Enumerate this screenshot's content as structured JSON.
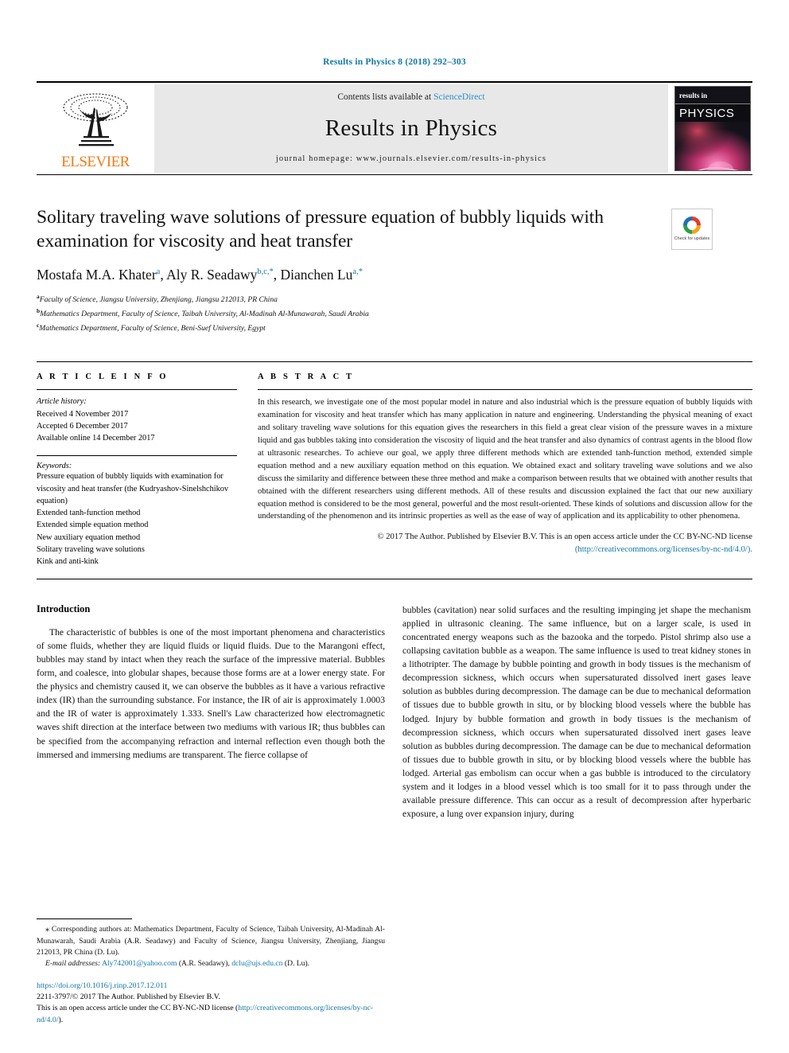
{
  "running_head": "Results in Physics 8 (2018) 292–303",
  "masthead": {
    "contents_prefix": "Contents lists available at ",
    "sciencedirect": "ScienceDirect",
    "journal_name": "Results in Physics",
    "homepage": "journal homepage: www.journals.elsevier.com/results-in-physics",
    "publisher": "ELSEVIER",
    "cover_top": "results in",
    "cover_title": "PHYSICS"
  },
  "article": {
    "title": "Solitary traveling wave solutions of pressure equation of bubbly liquids with examination for viscosity and heat transfer",
    "crossmark_label": "Check for updates",
    "authors_html": "Mostafa M.A. Khater a, Aly R. Seadawy b,c,*, Dianchen Lu a,*",
    "author1": "Mostafa M.A. Khater",
    "author1_sup": "a",
    "author2": "Aly R. Seadawy",
    "author2_sup": "b,c,*",
    "author3": "Dianchen Lu",
    "author3_sup": "a,*",
    "affiliations": [
      {
        "mark": "a",
        "text": "Faculty of Science, Jiangsu University, Zhenjiang, Jiangsu 212013, PR China"
      },
      {
        "mark": "b",
        "text": "Mathematics Department, Faculty of Science, Taibah University, Al-Madinah Al-Munawarah, Saudi Arabia"
      },
      {
        "mark": "c",
        "text": "Mathematics Department, Faculty of Science, Beni-Suef University, Egypt"
      }
    ]
  },
  "article_info": {
    "heading": "A R T I C L E   I N F O",
    "history_title": "Article history:",
    "history": [
      "Received 4 November 2017",
      "Accepted 6 December 2017",
      "Available online 14 December 2017"
    ],
    "keywords_title": "Keywords:",
    "keywords": [
      "Pressure equation of bubbly liquids with examination for viscosity and heat transfer (the Kudryashov-Sinelshchikov equation)",
      "Extended tanh-function method",
      "Extended simple equation method",
      "New auxiliary equation method",
      "Solitary traveling wave solutions",
      "Kink and anti-kink"
    ]
  },
  "abstract": {
    "heading": "A B S T R A C T",
    "text": "In this research, we investigate one of the most popular model in nature and also industrial which is the pressure equation of bubbly liquids with examination for viscosity and heat transfer which has many application in nature and engineering. Understanding the physical meaning of exact and solitary traveling wave solutions for this equation gives the researchers in this field a great clear vision of the pressure waves in a mixture liquid and gas bubbles taking into consideration the viscosity of liquid and the heat transfer and also dynamics of contrast agents in the blood flow at ultrasonic researches. To achieve our goal, we apply three different methods which are extended tanh-function method, extended simple equation method and a new auxiliary equation method on this equation. We obtained exact and solitary traveling wave solutions and we also discuss the similarity and difference between these three method and make a comparison between results that we obtained with another results that obtained with the different researchers using different methods. All of these results and discussion explained the fact that our new auxiliary equation method is considered to be the most general, powerful and the most result-oriented. These kinds of solutions and discussion allow for the understanding of the phenomenon and its intrinsic properties as well as the ease of way of application and its applicability to other phenomena.",
    "copyright": "© 2017 The Author. Published by Elsevier B.V. This is an open access article under the CC BY-NC-ND license",
    "license_url": "(http://creativecommons.org/licenses/by-nc-nd/4.0/)."
  },
  "body": {
    "intro_heading": "Introduction",
    "left_paragraph": "The characteristic of bubbles is one of the most important phenomena and characteristics of some fluids, whether they are liquid fluids or liquid fluids. Due to the Marangoni effect, bubbles may stand by intact when they reach the surface of the impressive material. Bubbles form, and coalesce, into globular shapes, because those forms are at a lower energy state. For the physics and chemistry caused it, we can observe the bubbles as it have a various refractive index (IR) than the surrounding substance. For instance, the IR of air is approximately 1.0003 and the IR of water is approximately 1.333. Snell's Law characterized how electromagnetic waves shift direction at the interface between two mediums with various IR; thus bubbles can be specified from the accompanying refraction and internal reflection even though both the immersed and immersing mediums are transparent. The fierce collapse of",
    "right_paragraph": "bubbles (cavitation) near solid surfaces and the resulting impinging jet shape the mechanism applied in ultrasonic cleaning. The same influence, but on a larger scale, is used in concentrated energy weapons such as the bazooka and the torpedo. Pistol shrimp also use a collapsing cavitation bubble as a weapon. The same influence is used to treat kidney stones in a lithotripter. The damage by bubble pointing and growth in body tissues is the mechanism of decompression sickness, which occurs when supersaturated dissolved inert gases leave solution as bubbles during decompression. The damage can be due to mechanical deformation of tissues due to bubble growth in situ, or by blocking blood vessels where the bubble has lodged. Injury by bubble formation and growth in body tissues is the mechanism of decompression sickness, which occurs when supersaturated dissolved inert gases leave solution as bubbles during decompression. The damage can be due to mechanical deformation of tissues due to bubble growth in situ, or by blocking blood vessels where the bubble has lodged. Arterial gas embolism can occur when a gas bubble is introduced to the circulatory system and it lodges in a blood vessel which is too small for it to pass through under the available pressure difference. This can occur as a result of decompression after hyperbaric exposure, a lung over expansion injury, during"
  },
  "footnotes": {
    "corresponding_star": "⁎",
    "corresponding": "Corresponding authors at: Mathematics Department, Faculty of Science, Taibah University, Al-Madinah Al-Munawarah, Saudi Arabia (A.R. Seadawy) and Faculty of Science, Jiangsu University, Zhenjiang, Jiangsu 212013, PR China (D. Lu).",
    "email_label": "E-mail addresses:",
    "email1": "Aly742001@yahoo.com",
    "email1_owner": "(A.R. Seadawy),",
    "email2": "dclu@ujs.edu.cn",
    "email2_owner": "(D. Lu).",
    "doi": "https://doi.org/10.1016/j.rinp.2017.12.011",
    "issn_line": "2211-3797/© 2017 The Author. Published by Elsevier B.V.",
    "license_prefix": "This is an open access article under the CC BY-NC-ND license (",
    "license_link": "http://creativecommons.org/licenses/by-nc-nd/4.0/",
    "license_suffix": ")."
  },
  "colors": {
    "link": "#1277a8",
    "elsevier_orange": "#f07c1a",
    "masthead_grey": "#e8e8e8"
  }
}
